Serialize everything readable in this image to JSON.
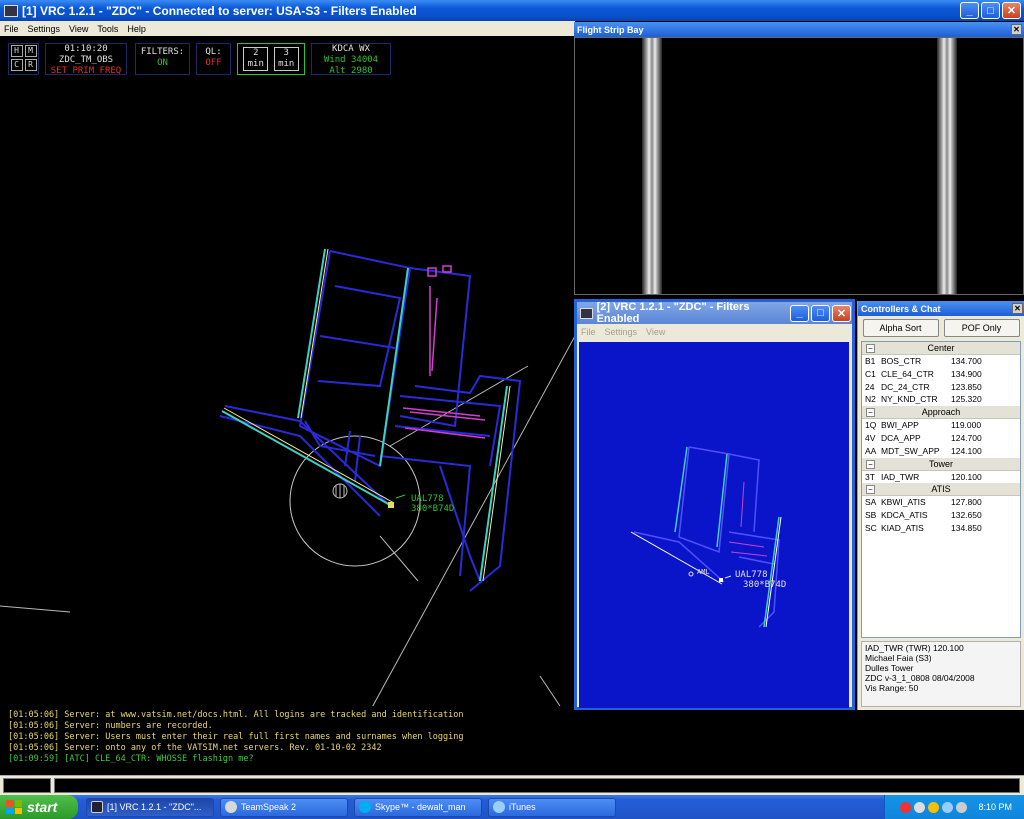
{
  "window": {
    "title": "[1] VRC 1.2.1 - \"ZDC\" - Connected to server: USA-S3 - Filters Enabled",
    "menu": [
      "File",
      "Settings",
      "View",
      "Tools",
      "Help"
    ]
  },
  "hud": {
    "keys": [
      "H",
      "M",
      "C",
      "R"
    ],
    "clock": "01:10:20",
    "callsign": "ZDC_TM_OBS",
    "prim_freq": "SET PRIM FREQ",
    "filters_label": "FILTERS:",
    "filters_value": "ON",
    "ql_label": "QL:",
    "ql_value": "OFF",
    "timer1": "2",
    "timer2": "3",
    "timer_unit": "min",
    "wx_station": "KDCA WX",
    "wx_wind": "Wind 34004",
    "wx_alt": "Alt 2980"
  },
  "radar": {
    "aircraft_callsign": "UAL778",
    "aircraft_data": "380*B74D"
  },
  "strip_bay": {
    "title": "Flight Strip Bay"
  },
  "window2": {
    "title": "[2] VRC 1.2.1 - \"ZDC\" - Filters Enabled",
    "menu": [
      "File",
      "Settings",
      "View"
    ],
    "aircraft_callsign": "UAL778",
    "aircraft_data": "380*B74D",
    "fix_label": "AML"
  },
  "controllers": {
    "title": "Controllers & Chat",
    "alpha_sort": "Alpha Sort",
    "pof_only": "POF Only",
    "groups": [
      {
        "name": "Center",
        "rows": [
          [
            "B1",
            "BOS_CTR",
            "134.700"
          ],
          [
            "C1",
            "CLE_64_CTR",
            "134.900"
          ],
          [
            "24",
            "DC_24_CTR",
            "123.850"
          ],
          [
            "N2",
            "NY_KND_CTR",
            "125.320"
          ]
        ]
      },
      {
        "name": "Approach",
        "rows": [
          [
            "1Q",
            "BWI_APP",
            "119.000"
          ],
          [
            "4V",
            "DCA_APP",
            "124.700"
          ],
          [
            "AA",
            "MDT_SW_APP",
            "124.100"
          ]
        ]
      },
      {
        "name": "Tower",
        "rows": [
          [
            "3T",
            "IAD_TWR",
            "120.100"
          ]
        ]
      },
      {
        "name": "ATIS",
        "rows": [
          [
            "SA",
            "KBWI_ATIS",
            "127.800"
          ],
          [
            "SB",
            "KDCA_ATIS",
            "132.650"
          ],
          [
            "SC",
            "KIAD_ATIS",
            "134.850"
          ]
        ]
      }
    ],
    "info": [
      "IAD_TWR (TWR) 120.100",
      "Michael Faia (S3)",
      "Dulles Tower",
      "ZDC v-3_1_0808 08/04/2008",
      "Vis Range: 50"
    ]
  },
  "chat": [
    {
      "text": "[01:05:06] Server: at www.vatsim.net/docs.html. All logins are tracked and identification",
      "type": "server"
    },
    {
      "text": "[01:05:06] Server: numbers are recorded.",
      "type": "server"
    },
    {
      "text": "[01:05:06] Server: Users must enter their real full first names and surnames when logging",
      "type": "server"
    },
    {
      "text": "[01:05:06] Server: onto any of the VATSIM.net servers. Rev. 01-10-02 2342",
      "type": "server"
    },
    {
      "text": "[01:09:59] [ATC] CLE_64_CTR: WHOSSE flashign me?",
      "type": "atc"
    }
  ],
  "taskbar": {
    "start": "start",
    "tasks": [
      "[1] VRC 1.2.1 - \"ZDC\"...",
      "TeamSpeak 2",
      "Skype™ - dewalt_man",
      "iTunes"
    ],
    "clock": "8:10 PM"
  },
  "colors": {
    "radar_bg": "#000000",
    "video_map": "#2a2ad8",
    "runway": "#40d0c0",
    "taxiway_pink": "#d040d0",
    "window2_bg": "#0a14c8"
  }
}
